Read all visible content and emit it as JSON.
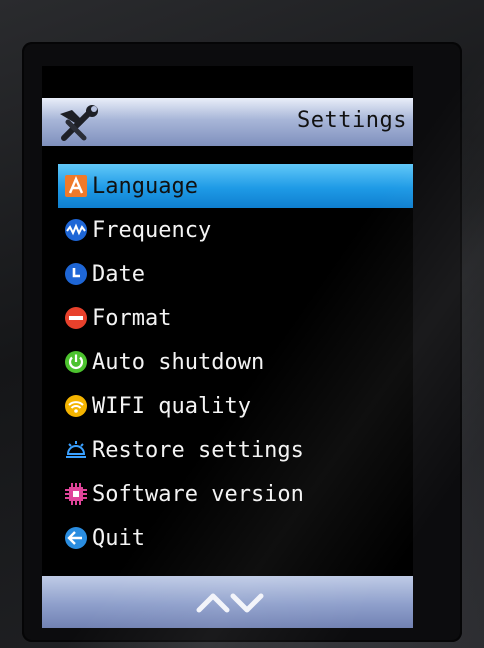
{
  "header": {
    "title": "Settings",
    "icon": "wrench-screwdriver-icon"
  },
  "menu": {
    "selected_index": 0,
    "items": [
      {
        "label": "Language",
        "icon": "language-icon",
        "color": "#f07a2a"
      },
      {
        "label": "Frequency",
        "icon": "waveform-icon",
        "color": "#1e66d6"
      },
      {
        "label": "Date",
        "icon": "clock-icon",
        "color": "#1e66d6"
      },
      {
        "label": "Format",
        "icon": "minus-circle-icon",
        "color": "#e8412c"
      },
      {
        "label": "Auto shutdown",
        "icon": "power-icon",
        "color": "#4cc22e"
      },
      {
        "label": "WIFI quality",
        "icon": "wifi-icon",
        "color": "#f4b400"
      },
      {
        "label": "Restore settings",
        "icon": "restore-icon",
        "color": "#1e66d6"
      },
      {
        "label": "Software version",
        "icon": "chip-icon",
        "color": "#e0449a"
      },
      {
        "label": "Quit",
        "icon": "back-arrow-icon",
        "color": "#2a8de0"
      }
    ]
  },
  "footer": {
    "up_icon": "chevron-up-icon",
    "down_icon": "chevron-down-icon"
  },
  "colors": {
    "selection": "#1e9ae6",
    "title_bar": "#a8b6d8",
    "screen_bg": "#000000"
  }
}
